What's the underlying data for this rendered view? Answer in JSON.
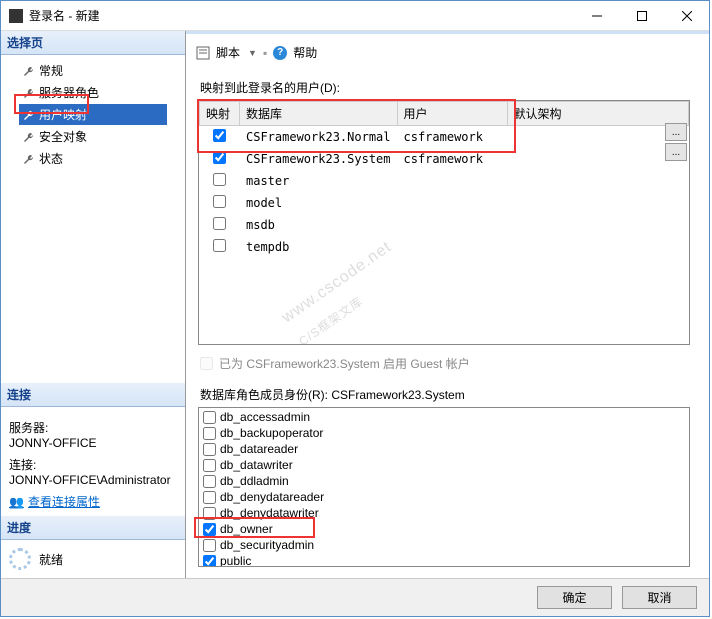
{
  "window": {
    "title": "登录名 - 新建"
  },
  "sidebar": {
    "header": "选择页",
    "items": [
      {
        "label": "常规"
      },
      {
        "label": "服务器角色"
      },
      {
        "label": "用户映射"
      },
      {
        "label": "安全对象"
      },
      {
        "label": "状态"
      }
    ]
  },
  "connection": {
    "header": "连接",
    "server_label": "服务器:",
    "server_value": "JONNY-OFFICE",
    "conn_label": "连接:",
    "conn_value": "JONNY-OFFICE\\Administrator",
    "view_link": "查看连接属性"
  },
  "progress": {
    "header": "进度",
    "status": "就绪"
  },
  "toolbar": {
    "script": "脚本",
    "help": "帮助"
  },
  "mapping": {
    "label": "映射到此登录名的用户(D):",
    "columns": [
      "映射",
      "数据库",
      "用户",
      "默认架构"
    ],
    "rows": [
      {
        "checked": true,
        "db": "CSFramework23.Normal",
        "user": "csframework",
        "schema": ""
      },
      {
        "checked": true,
        "db": "CSFramework23.System",
        "user": "csframework",
        "schema": ""
      },
      {
        "checked": false,
        "db": "master",
        "user": "",
        "schema": ""
      },
      {
        "checked": false,
        "db": "model",
        "user": "",
        "schema": ""
      },
      {
        "checked": false,
        "db": "msdb",
        "user": "",
        "schema": ""
      },
      {
        "checked": false,
        "db": "tempdb",
        "user": "",
        "schema": ""
      }
    ],
    "guest_label": "已为 CSFramework23.System 启用 Guest 帐户"
  },
  "roles": {
    "label": "数据库角色成员身份(R): CSFramework23.System",
    "items": [
      {
        "checked": false,
        "name": "db_accessadmin"
      },
      {
        "checked": false,
        "name": "db_backupoperator"
      },
      {
        "checked": false,
        "name": "db_datareader"
      },
      {
        "checked": false,
        "name": "db_datawriter"
      },
      {
        "checked": false,
        "name": "db_ddladmin"
      },
      {
        "checked": false,
        "name": "db_denydatareader"
      },
      {
        "checked": false,
        "name": "db_denydatawriter"
      },
      {
        "checked": true,
        "name": "db_owner"
      },
      {
        "checked": false,
        "name": "db_securityadmin"
      },
      {
        "checked": true,
        "name": "public"
      }
    ]
  },
  "footer": {
    "ok": "确定",
    "cancel": "取消"
  },
  "watermark": {
    "en": "www.cscode.net",
    "zh": "C/S框架文库"
  }
}
